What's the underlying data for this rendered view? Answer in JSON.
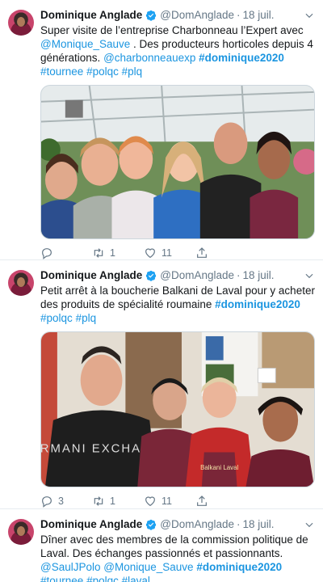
{
  "tweets": [
    {
      "name": "Dominique Anglade",
      "handle": "@DomAnglade",
      "date": "18 juil.",
      "text_parts": [
        {
          "t": "Super visite de l’entreprise Charbonneau l’Expert avec ",
          "k": "plain"
        },
        {
          "t": "@Monique_Sauve",
          "k": "link"
        },
        {
          "t": " . Des producteurs horticoles depuis 4 générations. ",
          "k": "plain"
        },
        {
          "t": "@charbonneauexp",
          "k": "link"
        },
        {
          "t": " ",
          "k": "plain"
        },
        {
          "t": "#dominique2020",
          "k": "bold"
        },
        {
          "t": " ",
          "k": "plain"
        },
        {
          "t": "#tournee",
          "k": "link"
        },
        {
          "t": " ",
          "k": "plain"
        },
        {
          "t": "#polqc",
          "k": "link"
        },
        {
          "t": " ",
          "k": "plain"
        },
        {
          "t": "#plq",
          "k": "link"
        }
      ],
      "replies": "",
      "retweets": "1",
      "likes": "11",
      "photo_alt": "group photo in a greenhouse"
    },
    {
      "name": "Dominique Anglade",
      "handle": "@DomAnglade",
      "date": "18 juil.",
      "text_parts": [
        {
          "t": "Petit arrêt à la boucherie Balkani de Laval pour y acheter des produits de spécialité roumaine ",
          "k": "plain"
        },
        {
          "t": "#dominique2020",
          "k": "bold"
        },
        {
          "t": " ",
          "k": "plain"
        },
        {
          "t": "#polqc",
          "k": "link"
        },
        {
          "t": " ",
          "k": "plain"
        },
        {
          "t": "#plq",
          "k": "link"
        }
      ],
      "replies": "3",
      "retweets": "1",
      "likes": "11",
      "apron_text": "Balkani Laval",
      "shirt_text": "ARMANI EXCHANGE"
    },
    {
      "name": "Dominique Anglade",
      "handle": "@DomAnglade",
      "date": "18 juil.",
      "text_parts": [
        {
          "t": "Dîner avec des membres de la commission politique de Laval. Des échanges passionnés et passionnants. ",
          "k": "plain"
        },
        {
          "t": "@SaulJPolo",
          "k": "link"
        },
        {
          "t": " ",
          "k": "plain"
        },
        {
          "t": "@Monique_Sauve",
          "k": "link"
        },
        {
          "t": " ",
          "k": "plain"
        },
        {
          "t": "#dominique2020",
          "k": "bold"
        },
        {
          "t": " ",
          "k": "plain"
        },
        {
          "t": "#tournee",
          "k": "link"
        },
        {
          "t": " ",
          "k": "plain"
        },
        {
          "t": "#polqc",
          "k": "link"
        },
        {
          "t": " ",
          "k": "plain"
        },
        {
          "t": "#laval",
          "k": "link"
        }
      ]
    }
  ],
  "icons": {
    "reply": "reply-icon",
    "retweet": "retweet-icon",
    "like": "heart-icon",
    "share": "share-icon",
    "verified": "verified-badge-icon",
    "caret": "chevron-down-icon"
  },
  "colors": {
    "link": "#1b95e0",
    "text": "#14171a",
    "muted": "#657786",
    "border": "#e6ecf0"
  }
}
